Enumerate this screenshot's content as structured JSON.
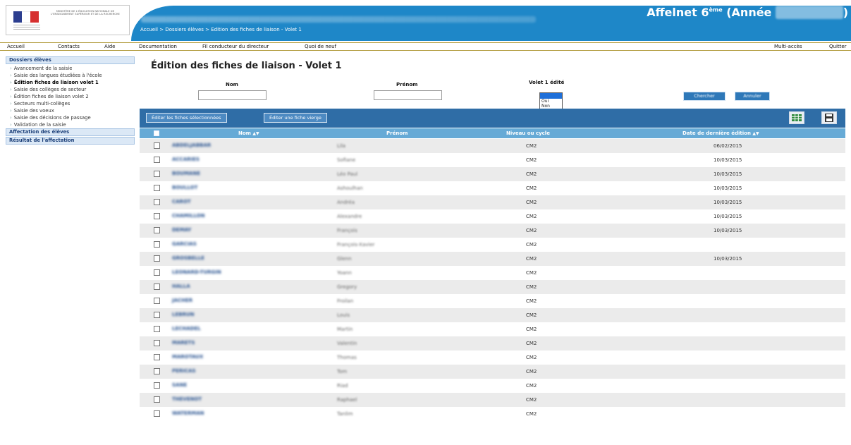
{
  "header": {
    "blurred_info": "Pays · Inspection · Établissement · Directeur",
    "breadcrumb": "Accueil > Dossiers élèves > Edition des fiches de liaison - Volet 1",
    "app_title": "Affelnet 6",
    "app_title_sup": "ème",
    "app_title_year_open": " (Année ",
    "app_title_year": "2015-2016",
    "app_title_close": ")",
    "logo_text": "MINISTÈRE DE L'ÉDUCATION NATIONALE DE L'ENSEIGNEMENT SUPÉRIEUR ET DE LA RECHERCHE"
  },
  "menu": {
    "accueil": "Accueil",
    "contacts": "Contacts",
    "aide": "Aide",
    "documentation": "Documentation",
    "fil_conducteur": "Fil conducteur du directeur",
    "quoi_de_neuf": "Quoi de neuf",
    "multi_acces": "Multi-accès",
    "quitter": "Quitter"
  },
  "sidebar": {
    "section1": "Dossiers élèves",
    "items": [
      "Avancement de la saisie",
      "Saisie des langues étudiées à l'école",
      "Édition fiches de liaison volet 1",
      "Saisie des collèges de secteur",
      "Édition fiches de liaison volet 2",
      "Secteurs multi-collèges",
      "Saisie des voeux",
      "Saisie des décisions de passage",
      "Validation de la saisie"
    ],
    "section2": "Affectation des élèves",
    "section3": "Résultat de l'affectation"
  },
  "main": {
    "title": "Édition des fiches de liaison - Volet 1",
    "filters": {
      "nom_label": "Nom",
      "prenom_label": "Prénom",
      "volet_label": "Volet 1 édité",
      "volet_options": [
        "Oui",
        "Non"
      ],
      "chercher": "Chercher",
      "annuler": "Annuler"
    },
    "toolbar": {
      "edit_selected": "Éditer les fiches sélectionnées",
      "edit_blank": "Éditer une fiche vierge"
    },
    "columns": {
      "nom": "Nom",
      "prenom": "Prénom",
      "niveau": "Niveau ou cycle",
      "date": "Date de dernière édition"
    },
    "rows": [
      {
        "nom": "ABDELJABBAR",
        "prenom": "Lila",
        "niveau": "CM2",
        "date": "06/02/2015"
      },
      {
        "nom": "ACCARIES",
        "prenom": "Sofiane",
        "niveau": "CM2",
        "date": "10/03/2015"
      },
      {
        "nom": "BOUMANE",
        "prenom": "Léo Paul",
        "niveau": "CM2",
        "date": "10/03/2015"
      },
      {
        "nom": "BOULLOT",
        "prenom": "Ashoulhan",
        "niveau": "CM2",
        "date": "10/03/2015"
      },
      {
        "nom": "CAROT",
        "prenom": "Andréa",
        "niveau": "CM2",
        "date": "10/03/2015"
      },
      {
        "nom": "CHAMILLON",
        "prenom": "Alexandre",
        "niveau": "CM2",
        "date": "10/03/2015"
      },
      {
        "nom": "DEMAY",
        "prenom": "François",
        "niveau": "CM2",
        "date": "10/03/2015"
      },
      {
        "nom": "GARCIAS",
        "prenom": "François-Xavier",
        "niveau": "CM2",
        "date": ""
      },
      {
        "nom": "GROSBELLE",
        "prenom": "Glenn",
        "niveau": "CM2",
        "date": "10/03/2015"
      },
      {
        "nom": "LEONARD-TURGIN",
        "prenom": "Yoann",
        "niveau": "CM2",
        "date": ""
      },
      {
        "nom": "HALLA",
        "prenom": "Gregory",
        "niveau": "CM2",
        "date": ""
      },
      {
        "nom": "JACHER",
        "prenom": "Froilan",
        "niveau": "CM2",
        "date": ""
      },
      {
        "nom": "LEBRUN",
        "prenom": "Louis",
        "niveau": "CM2",
        "date": ""
      },
      {
        "nom": "LECHADEL",
        "prenom": "Martin",
        "niveau": "CM2",
        "date": ""
      },
      {
        "nom": "MARETS",
        "prenom": "Valentin",
        "niveau": "CM2",
        "date": ""
      },
      {
        "nom": "MAROTAUX",
        "prenom": "Thomas",
        "niveau": "CM2",
        "date": ""
      },
      {
        "nom": "PERICAS",
        "prenom": "Tom",
        "niveau": "CM2",
        "date": ""
      },
      {
        "nom": "SANE",
        "prenom": "Riad",
        "niveau": "CM2",
        "date": ""
      },
      {
        "nom": "THEVENOT",
        "prenom": "Raphael",
        "niveau": "CM2",
        "date": ""
      },
      {
        "nom": "WATERMAN",
        "prenom": "Tanlim",
        "niveau": "CM2",
        "date": ""
      }
    ]
  },
  "colors": {
    "banner": "#1e87c8",
    "toolbar": "#2f6da6",
    "table_header": "#66aad6",
    "link": "#25508e"
  }
}
